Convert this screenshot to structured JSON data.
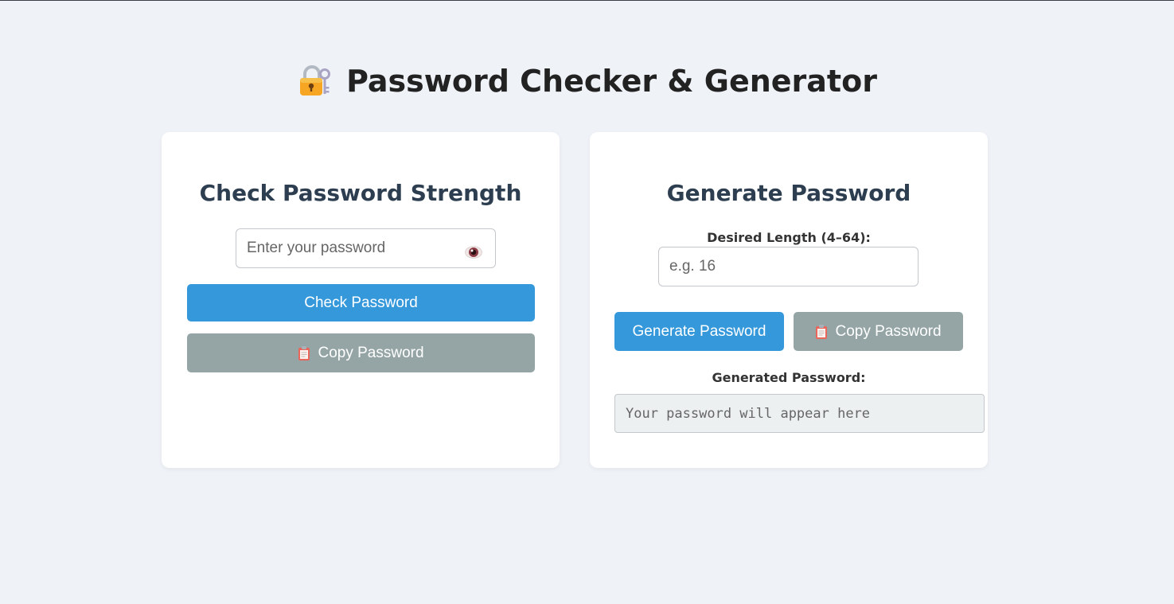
{
  "header": {
    "title": "Password Checker & Generator",
    "icon": "locked-with-key-icon"
  },
  "checker": {
    "title": "Check Password Strength",
    "password_placeholder": "Enter your password",
    "toggle_icon": "eye-icon",
    "check_label": "Check Password",
    "copy_label": "Copy Password",
    "copy_icon": "clipboard-icon"
  },
  "generator": {
    "title": "Generate Password",
    "length_label": "Desired Length (4–64):",
    "length_placeholder": "e.g. 16",
    "generate_label": "Generate Password",
    "copy_label": "Copy Password",
    "copy_icon": "clipboard-icon",
    "output_label": "Generated Password:",
    "output_placeholder": "Your password will appear here"
  },
  "colors": {
    "background": "#eff2f7",
    "primary": "#3498db",
    "secondary": "#95a5a6",
    "heading": "#2c3e50",
    "output_bg": "#ecf0f1"
  }
}
